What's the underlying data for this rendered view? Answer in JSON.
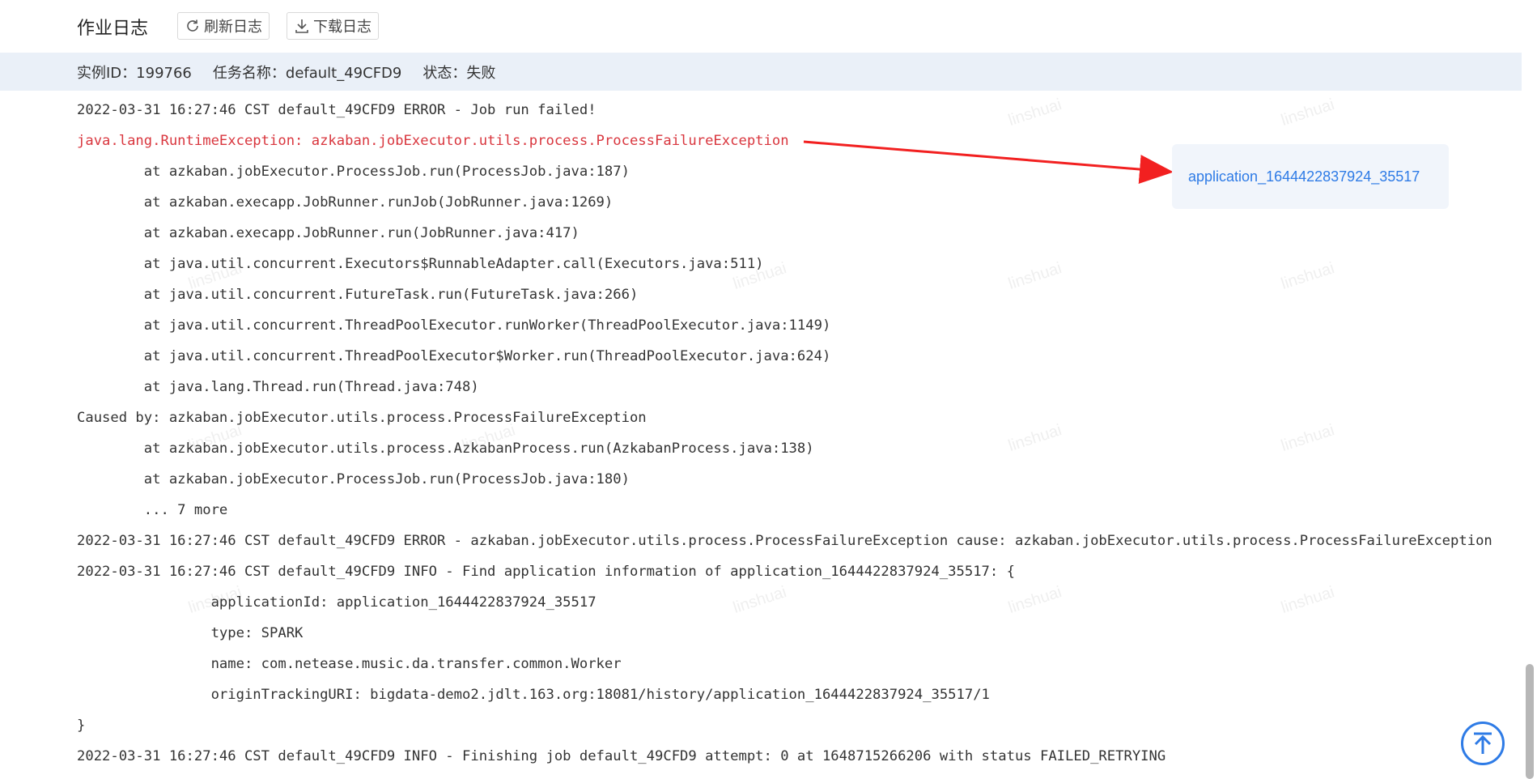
{
  "header": {
    "title": "作业日志",
    "refresh_label": "刷新日志",
    "download_label": "下载日志"
  },
  "info_bar": {
    "instance": "实例ID：199766",
    "task_name": "任务名称：default_49CFD9",
    "status": "状态：失败"
  },
  "watermark_text": "linshuai",
  "log_lines": [
    {
      "text": "2022-03-31 16:27:46 CST default_49CFD9 ERROR - Job run failed!",
      "level": "normal"
    },
    {
      "text": "java.lang.RuntimeException: azkaban.jobExecutor.utils.process.ProcessFailureException",
      "level": "error"
    },
    {
      "text": "        at azkaban.jobExecutor.ProcessJob.run(ProcessJob.java:187)",
      "level": "normal"
    },
    {
      "text": "        at azkaban.execapp.JobRunner.runJob(JobRunner.java:1269)",
      "level": "normal"
    },
    {
      "text": "        at azkaban.execapp.JobRunner.run(JobRunner.java:417)",
      "level": "normal"
    },
    {
      "text": "        at java.util.concurrent.Executors$RunnableAdapter.call(Executors.java:511)",
      "level": "normal"
    },
    {
      "text": "        at java.util.concurrent.FutureTask.run(FutureTask.java:266)",
      "level": "normal"
    },
    {
      "text": "        at java.util.concurrent.ThreadPoolExecutor.runWorker(ThreadPoolExecutor.java:1149)",
      "level": "normal"
    },
    {
      "text": "        at java.util.concurrent.ThreadPoolExecutor$Worker.run(ThreadPoolExecutor.java:624)",
      "level": "normal"
    },
    {
      "text": "        at java.lang.Thread.run(Thread.java:748)",
      "level": "normal"
    },
    {
      "text": "Caused by: azkaban.jobExecutor.utils.process.ProcessFailureException",
      "level": "normal"
    },
    {
      "text": "        at azkaban.jobExecutor.utils.process.AzkabanProcess.run(AzkabanProcess.java:138)",
      "level": "normal"
    },
    {
      "text": "        at azkaban.jobExecutor.ProcessJob.run(ProcessJob.java:180)",
      "level": "normal"
    },
    {
      "text": "        ... 7 more",
      "level": "normal"
    },
    {
      "text": "2022-03-31 16:27:46 CST default_49CFD9 ERROR - azkaban.jobExecutor.utils.process.ProcessFailureException cause: azkaban.jobExecutor.utils.process.ProcessFailureException",
      "level": "normal"
    },
    {
      "text": "2022-03-31 16:27:46 CST default_49CFD9 INFO - Find application information of application_1644422837924_35517: {",
      "level": "normal"
    },
    {
      "text": "                applicationId: application_1644422837924_35517",
      "level": "normal"
    },
    {
      "text": "                type: SPARK",
      "level": "normal"
    },
    {
      "text": "                name: com.netease.music.da.transfer.common.Worker",
      "level": "normal"
    },
    {
      "text": "                originTrackingURI: bigdata-demo2.jdlt.163.org:18081/history/application_1644422837924_35517/1",
      "level": "normal"
    },
    {
      "text": "}",
      "level": "normal"
    },
    {
      "text": "2022-03-31 16:27:46 CST default_49CFD9 INFO - Finishing job default_49CFD9 attempt: 0 at 1648715266206 with status FAILED_RETRYING",
      "level": "normal"
    }
  ],
  "callout": {
    "application_id": "application_1644422837924_35517"
  },
  "colors": {
    "error_text": "#d9363e",
    "link_blue": "#2e7be6",
    "arrow_red": "#f22020",
    "info_bar_bg": "#eaf0f8"
  }
}
